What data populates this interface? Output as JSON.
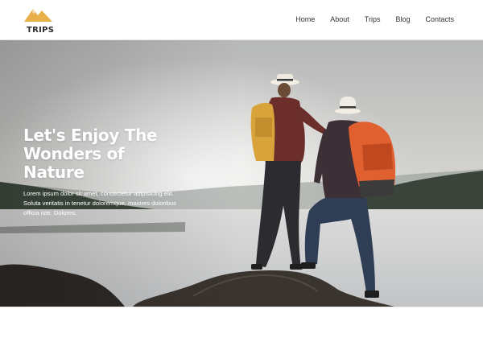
{
  "brand": {
    "name": "TRIPS",
    "accent": "#e8b04b"
  },
  "nav": {
    "items": [
      {
        "label": "Home"
      },
      {
        "label": "About"
      },
      {
        "label": "Trips"
      },
      {
        "label": "Blog"
      },
      {
        "label": "Contacts"
      }
    ]
  },
  "hero": {
    "title_lines": [
      "Let's Enjoy The",
      "Wonders of",
      "Nature"
    ],
    "description_lines": [
      "Lorem ipsum dolor sit amet, consectetur adipisicing elit.",
      "Soluta veritatis in tenetur doloremque, maiores doloribus",
      "officia iste. Dolores."
    ]
  },
  "colors": {
    "sky": "#c9ccd0",
    "water": "#d4d6d8",
    "rock": "#3a3632",
    "text_dark": "#333333"
  }
}
